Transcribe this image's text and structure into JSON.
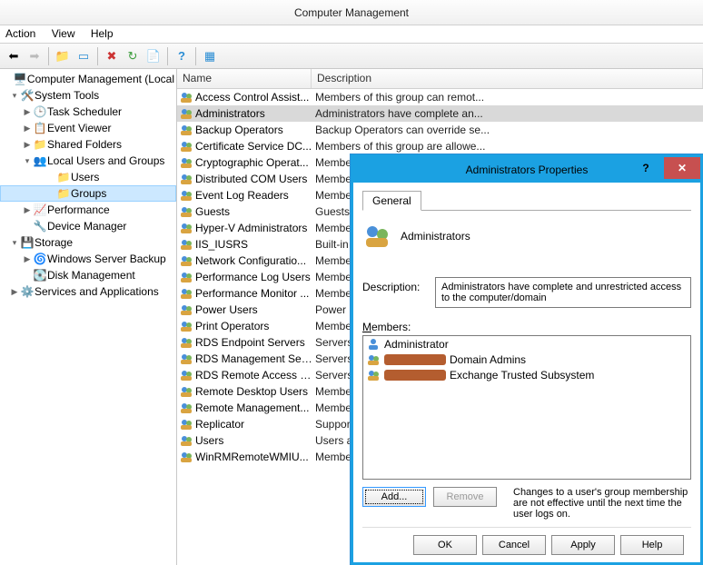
{
  "window": {
    "title": "Computer Management"
  },
  "menu": {
    "action": "Action",
    "view": "View",
    "help": "Help"
  },
  "tree": {
    "root": "Computer Management (Local",
    "systools": "System Tools",
    "tasksched": "Task Scheduler",
    "eventviewer": "Event Viewer",
    "sharedfolders": "Shared Folders",
    "localusers": "Local Users and Groups",
    "users": "Users",
    "groups": "Groups",
    "performance": "Performance",
    "devmgr": "Device Manager",
    "storage": "Storage",
    "wsb": "Windows Server Backup",
    "diskmgmt": "Disk Management",
    "services": "Services and Applications"
  },
  "list": {
    "cols": {
      "name": "Name",
      "desc": "Description"
    },
    "rows": [
      {
        "name": "Access Control Assist...",
        "desc": "Members of this group can remot..."
      },
      {
        "name": "Administrators",
        "desc": "Administrators have complete an...",
        "selected": true
      },
      {
        "name": "Backup Operators",
        "desc": "Backup Operators can override se..."
      },
      {
        "name": "Certificate Service DC...",
        "desc": "Members of this group are allowe..."
      },
      {
        "name": "Cryptographic Operat...",
        "desc": "Membe"
      },
      {
        "name": "Distributed COM Users",
        "desc": "Membe"
      },
      {
        "name": "Event Log Readers",
        "desc": "Membe"
      },
      {
        "name": "Guests",
        "desc": "Guests"
      },
      {
        "name": "Hyper-V Administrators",
        "desc": "Membe"
      },
      {
        "name": "IIS_IUSRS",
        "desc": "Built-in"
      },
      {
        "name": "Network Configuratio...",
        "desc": "Membe"
      },
      {
        "name": "Performance Log Users",
        "desc": "Membe"
      },
      {
        "name": "Performance Monitor ...",
        "desc": "Membe"
      },
      {
        "name": "Power Users",
        "desc": "Power U"
      },
      {
        "name": "Print Operators",
        "desc": "Membe"
      },
      {
        "name": "RDS Endpoint Servers",
        "desc": "Servers"
      },
      {
        "name": "RDS Management Ser...",
        "desc": "Servers"
      },
      {
        "name": "RDS Remote Access S...",
        "desc": "Servers"
      },
      {
        "name": "Remote Desktop Users",
        "desc": "Membe"
      },
      {
        "name": "Remote Management...",
        "desc": "Membe"
      },
      {
        "name": "Replicator",
        "desc": "Suppor"
      },
      {
        "name": "Users",
        "desc": "Users ar"
      },
      {
        "name": "WinRMRemoteWMIU...",
        "desc": "Membe"
      }
    ]
  },
  "dialog": {
    "title": "Administrators Properties",
    "tab_general": "General",
    "group_name": "Administrators",
    "desc_label": "Description:",
    "desc_value": "Administrators have complete and unrestricted access to the computer/domain",
    "members_label": "Members:",
    "members": [
      {
        "type": "user",
        "name": "Administrator"
      },
      {
        "type": "group",
        "redacted": true,
        "suffix": "Domain Admins"
      },
      {
        "type": "group",
        "redacted": true,
        "suffix": "Exchange Trusted Subsystem"
      }
    ],
    "add": "Add...",
    "remove": "Remove",
    "note": "Changes to a user's group membership are not effective until the next time the user logs on.",
    "ok": "OK",
    "cancel": "Cancel",
    "apply": "Apply",
    "help": "Help"
  }
}
